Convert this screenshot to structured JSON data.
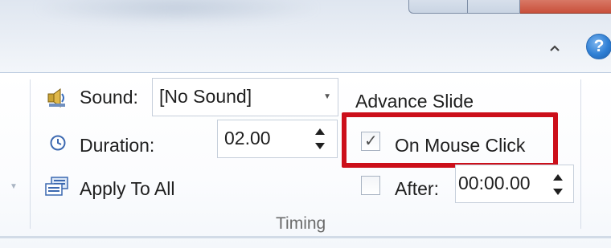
{
  "ribbon": {
    "sound": {
      "label": "Sound:",
      "value": "[No Sound]"
    },
    "duration": {
      "label": "Duration:",
      "value": "02.00"
    },
    "apply_all": {
      "label": "Apply To All"
    },
    "advance": {
      "title": "Advance Slide",
      "on_mouse_click": {
        "label": "On Mouse Click",
        "checked": true,
        "check_glyph": "✓"
      },
      "after": {
        "label": "After:",
        "checked": false,
        "value": "00:00.00"
      }
    },
    "group_label": "Timing"
  },
  "window": {
    "help_glyph": "?",
    "collapse_icon": "chevron-up-icon"
  },
  "colors": {
    "highlight": "#cc0f1a",
    "help_blue": "#2f7fd4"
  }
}
